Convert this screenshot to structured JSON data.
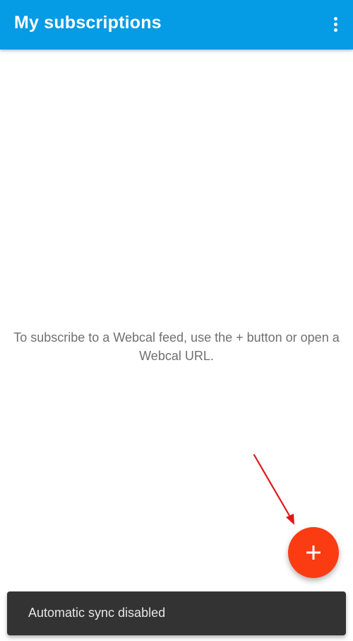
{
  "app_bar": {
    "title": "My subscriptions",
    "background_color": "#059be5",
    "overflow_icon": "more-vert-icon"
  },
  "main": {
    "empty_message": "To subscribe to a Webcal feed, use the + button or open a Webcal URL."
  },
  "fab": {
    "icon": "plus-icon",
    "color": "#fb3b12"
  },
  "annotation": {
    "icon": "red-arrow-icon",
    "color": "#e0161c"
  },
  "snackbar": {
    "message": "Automatic sync disabled"
  }
}
